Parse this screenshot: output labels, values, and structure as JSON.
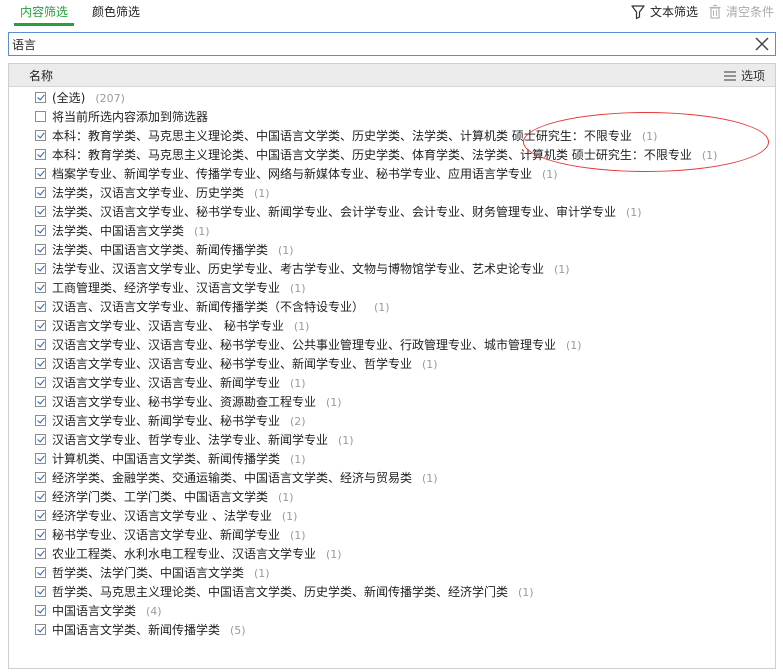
{
  "tabs": [
    {
      "label": "内容筛选",
      "active": true
    },
    {
      "label": "颜色筛选",
      "active": false
    }
  ],
  "toolbar": {
    "text_filter_label": "文本筛选",
    "clear_label": "清空条件"
  },
  "search": {
    "value": "语言"
  },
  "list_header": {
    "name_col": "名称",
    "options_label": "选项"
  },
  "items": [
    {
      "label": "(全选)",
      "count": "(207)",
      "checked": true
    },
    {
      "label": "将当前所选内容添加到筛选器",
      "count": "",
      "checked": false
    },
    {
      "label": "本科：教育学类、马克思主义理论类、中国语言文学类、历史学类、法学类、计算机类       硕士研究生：不限专业",
      "count": "(1)",
      "checked": true
    },
    {
      "label": "本科：教育学类、马克思主义理论类、中国语言文学类、历史学类、体育学类、法学类、计算机类        硕士研究生：不限专业",
      "count": "(1)",
      "checked": true
    },
    {
      "label": "档案学专业、新闻学专业、传播学专业、网络与新媒体专业、秘书学专业、应用语言学专业",
      "count": "(1)",
      "checked": true
    },
    {
      "label": "法学类，汉语言文学专业、历史学类",
      "count": "(1)",
      "checked": true
    },
    {
      "label": "法学类、汉语言文学专业、秘书学专业、新闻学专业、会计学专业、会计专业、财务管理专业、审计学专业",
      "count": "(1)",
      "checked": true
    },
    {
      "label": "法学类、中国语言文学类",
      "count": "(1)",
      "checked": true
    },
    {
      "label": "法学类、中国语言文学类、新闻传播学类",
      "count": "(1)",
      "checked": true
    },
    {
      "label": "法学专业、汉语言文学专业、历史学专业、考古学专业、文物与博物馆学专业、艺术史论专业",
      "count": "(1)",
      "checked": true
    },
    {
      "label": "工商管理类、经济学专业、汉语言文学专业",
      "count": "(1)",
      "checked": true
    },
    {
      "label": "汉语言、汉语言文学专业、新闻传播学类（不含特设专业）",
      "count": "(1)",
      "checked": true
    },
    {
      "label": "汉语言文学专业、汉语言专业、 秘书学专业",
      "count": "(1)",
      "checked": true
    },
    {
      "label": "汉语言文学专业、汉语言专业、秘书学专业、公共事业管理专业、行政管理专业、城市管理专业",
      "count": "(1)",
      "checked": true
    },
    {
      "label": "汉语言文学专业、汉语言专业、秘书学专业、新闻学专业、哲学专业",
      "count": "(1)",
      "checked": true
    },
    {
      "label": "汉语言文学专业、汉语言专业、新闻学专业",
      "count": "(1)",
      "checked": true
    },
    {
      "label": "汉语言文学专业、秘书学专业、资源勘查工程专业",
      "count": "(1)",
      "checked": true
    },
    {
      "label": "汉语言文学专业、新闻学专业、秘书学专业",
      "count": "(2)",
      "checked": true
    },
    {
      "label": "汉语言文学专业、哲学专业、法学专业、新闻学专业",
      "count": "(1)",
      "checked": true
    },
    {
      "label": "计算机类、中国语言文学类、新闻传播学类",
      "count": "(1)",
      "checked": true
    },
    {
      "label": "经济学类、金融学类、交通运输类、中国语言文学类、经济与贸易类",
      "count": "(1)",
      "checked": true
    },
    {
      "label": "经济学门类、工学门类、中国语言文学类",
      "count": "(1)",
      "checked": true
    },
    {
      "label": "经济学专业、汉语言文学专业 、法学专业",
      "count": "(1)",
      "checked": true
    },
    {
      "label": "秘书学专业、汉语言文学专业、新闻学专业",
      "count": "(1)",
      "checked": true
    },
    {
      "label": "农业工程类、水利水电工程专业、汉语言文学专业",
      "count": "(1)",
      "checked": true
    },
    {
      "label": "哲学类、法学门类、中国语言文学类",
      "count": "(1)",
      "checked": true
    },
    {
      "label": "哲学类、马克思主义理论类、中国语言文学类、历史学类、新闻传播学类、经济学门类",
      "count": "(1)",
      "checked": true
    },
    {
      "label": "中国语言文学类",
      "count": "(4)",
      "checked": true
    },
    {
      "label": "中国语言文学类、新闻传播学类",
      "count": "(5)",
      "checked": true
    }
  ],
  "colors": {
    "accent": "#2a9d3f",
    "annotation": "#e53935",
    "check": "#2b5ea8"
  }
}
